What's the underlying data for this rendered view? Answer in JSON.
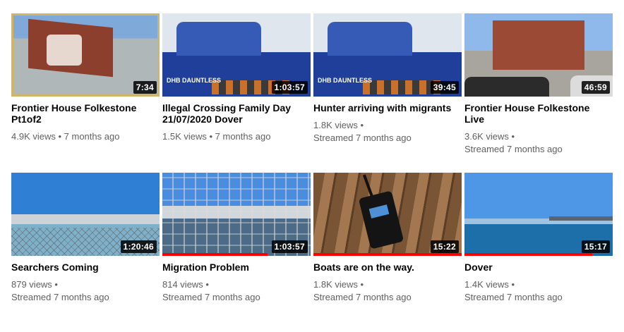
{
  "videos": [
    {
      "title": "Frontier House Folkestone Pt1of2",
      "duration": "7:34",
      "views": "4.9K views",
      "age": "7 months ago",
      "streamed": false,
      "progress": 0
    },
    {
      "title": "Illegal Crossing Family Day 21/07/2020 Dover",
      "duration": "1:03:57",
      "views": "1.5K views",
      "age": "7 months ago",
      "streamed": false,
      "progress": 0,
      "boat_label": "DHB DAUNTLESS"
    },
    {
      "title": "Hunter arriving with migrants",
      "duration": "39:45",
      "views": "1.8K views",
      "age": "Streamed 7 months ago",
      "streamed": true,
      "progress": 0,
      "boat_label": "DHB DAUNTLESS"
    },
    {
      "title": "Frontier House Folkestone Live",
      "duration": "46:59",
      "views": "3.6K views",
      "age": "Streamed 7 months ago",
      "streamed": true,
      "progress": 0
    },
    {
      "title": "Searchers Coming",
      "duration": "1:20:46",
      "views": "879 views",
      "age": "Streamed 7 months ago",
      "streamed": true,
      "progress": 0
    },
    {
      "title": "Migration Problem",
      "duration": "1:03:57",
      "views": "814 views",
      "age": "Streamed 7 months ago",
      "streamed": true,
      "progress": 0.71
    },
    {
      "title": "Boats are on the way.",
      "duration": "15:22",
      "views": "1.8K views",
      "age": "Streamed 7 months ago",
      "streamed": true,
      "progress": 1.0
    },
    {
      "title": "Dover",
      "duration": "15:17",
      "views": "1.4K views",
      "age": "Streamed 7 months ago",
      "streamed": true,
      "progress": 0.86
    }
  ],
  "colors": {
    "progress": "#ff0000",
    "title": "#030303",
    "meta": "#606060"
  }
}
